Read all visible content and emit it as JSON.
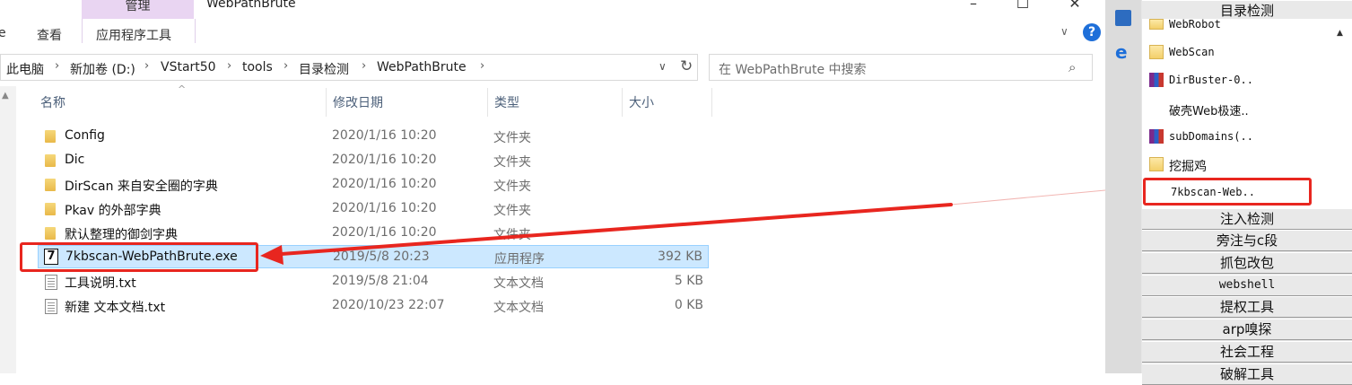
{
  "window": {
    "title": "WebPathBrute"
  },
  "ribbon": {
    "tabs": [
      "e",
      "查看"
    ],
    "context_tab": "管理",
    "context_group": "应用程序工具"
  },
  "address": {
    "crumbs": [
      "此电脑",
      "新加卷 (D:)",
      "VStart50",
      "tools",
      "目录检测",
      "WebPathBrute"
    ]
  },
  "search": {
    "placeholder": "在 WebPathBrute 中搜索"
  },
  "columns": {
    "name": "名称",
    "date": "修改日期",
    "type": "类型",
    "size": "大小"
  },
  "files": [
    {
      "name": "Config",
      "date": "2020/1/16 10:20",
      "type": "文件夹",
      "size": "",
      "icon": "folder-icon"
    },
    {
      "name": "Dic",
      "date": "2020/1/16 10:20",
      "type": "文件夹",
      "size": "",
      "icon": "folder-icon"
    },
    {
      "name": "DirScan 来自安全圈的字典",
      "date": "2020/1/16 10:20",
      "type": "文件夹",
      "size": "",
      "icon": "folder-icon"
    },
    {
      "name": "Pkav 的外部字典",
      "date": "2020/1/16 10:20",
      "type": "文件夹",
      "size": "",
      "icon": "folder-icon"
    },
    {
      "name": "默认整理的御剑字典",
      "date": "2020/1/16 10:20",
      "type": "文件夹",
      "size": "",
      "icon": "folder-icon"
    },
    {
      "name": "7kbscan-WebPathBrute.exe",
      "date": "2019/5/8 20:23",
      "type": "应用程序",
      "size": "392 KB",
      "icon": "exe-icon"
    },
    {
      "name": "工具说明.txt",
      "date": "2019/5/8 21:04",
      "type": "文本文档",
      "size": "5 KB",
      "icon": "text-file-icon"
    },
    {
      "name": "新建 文本文档.txt",
      "date": "2020/10/23 22:07",
      "type": "文本文档",
      "size": "0 KB",
      "icon": "text-file-icon"
    }
  ],
  "right_panel": {
    "header": "目录检测",
    "items": [
      {
        "label": "WebRobot",
        "icon": "folder-icon"
      },
      {
        "label": "WebScan",
        "icon": "folder-icon"
      },
      {
        "label": "DirBuster-0..",
        "icon": "archive-icon"
      },
      {
        "label": "破壳Web极速..",
        "icon": ""
      },
      {
        "label": "subDomains(..",
        "icon": "archive-icon"
      },
      {
        "label": "挖掘鸡",
        "icon": "folder-icon"
      },
      {
        "label": "7kbscan-Web..",
        "icon": ""
      }
    ],
    "categories": [
      "注入检测",
      "旁注与c段",
      "抓包改包",
      "webshell",
      "提权工具",
      "arp嗅探",
      "社会工程",
      "破解工具"
    ]
  },
  "colors": {
    "highlight": "#e8261f",
    "selection": "#cce8ff",
    "context_tab": "#e9d5f2"
  }
}
